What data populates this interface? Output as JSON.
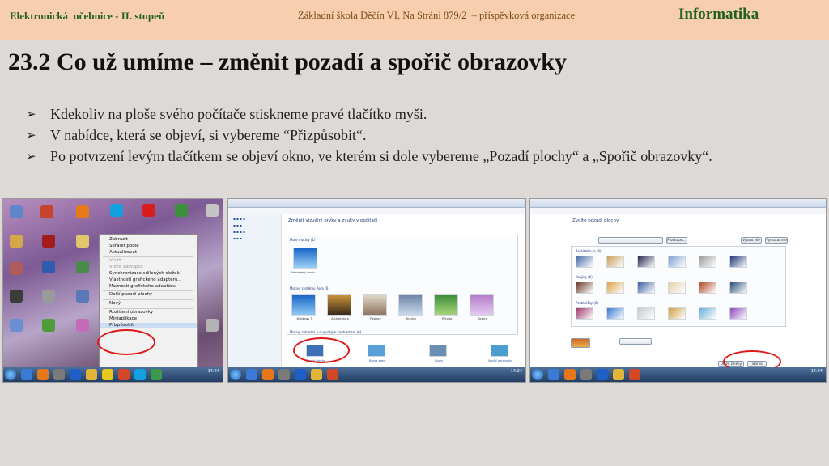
{
  "header": {
    "left": "Elektronická  učebnice - II. stupeň",
    "center": "Základní škola Děčín VI, Na Stráni 879/2  – příspěvková organizace",
    "right": "Informatika"
  },
  "title": "23.2 Co už umíme – změnit pozadí a spořič obrazovky",
  "bullets": [
    "Kdekoliv na ploše svého počítače stiskneme pravé tlačítko myši.",
    "V nabídce, která se objeví, si vybereme “Přizpůsobit“.",
    "Po potvrzení levým tlačítkem se objeví okno, ve kterém si dole vybereme „Pozadí plochy“ a „Spořič obrazovky“."
  ],
  "screenshot1": {
    "context_menu": [
      {
        "label": "Zobrazit",
        "state": "normal"
      },
      {
        "label": "Seřadit podle",
        "state": "normal"
      },
      {
        "label": "Aktualizovat",
        "state": "normal"
      },
      {
        "sep": true
      },
      {
        "label": "Vložit",
        "state": "dim"
      },
      {
        "label": "Vložit zástupce",
        "state": "dim"
      },
      {
        "label": "Synchronizace sdílených složek",
        "state": "normal"
      },
      {
        "label": "Vlastnosti grafického adaptéru...",
        "state": "normal"
      },
      {
        "label": "Možnosti grafického adaptéru",
        "state": "normal"
      },
      {
        "sep": true
      },
      {
        "label": "Další pozadí plochy",
        "state": "normal"
      },
      {
        "sep": true
      },
      {
        "label": "Nový",
        "state": "normal"
      },
      {
        "sep": true
      },
      {
        "label": "Rozlišení obrazovky",
        "state": "normal"
      },
      {
        "label": "Miniaplikace",
        "state": "normal"
      },
      {
        "label": "Přizpůsobit",
        "state": "highlight"
      }
    ],
    "clock": "14:24"
  },
  "screenshot2": {
    "window_title": "Změnit vizuální prvky a zvuky v počítači",
    "section_my": "Moje motivy (1)",
    "my_theme": "Neuložený motiv",
    "section_installed": "Motivy systému Aero (6)",
    "themes": [
      "Windows 7",
      "Architektura",
      "Postavy",
      "Krajiny",
      "Příroda",
      "Scény"
    ],
    "section_basic": "Motivy základní a s vysokým kontrastem (6)",
    "bottom": [
      "Pozadí plochy",
      "Barva oken",
      "Zvuky",
      "Spořič obrazovky"
    ],
    "clock": "14:24"
  },
  "screenshot3": {
    "window_title": "Zvolte pozadí plochy",
    "groups": [
      "Architektura (6)",
      "Krajiny (6)",
      "Postavičky (6)"
    ],
    "buttons": [
      "Vybrat vše",
      "Vymazat vše"
    ],
    "browse": "Procházet...",
    "save": "Uložit změny",
    "cancel": "Storno",
    "clock": "14:24"
  },
  "colors": {
    "header_bg": "#f7cfae",
    "header_green": "#215f22",
    "page_bg": "#ddd9d6",
    "circle_red": "#e01818"
  }
}
